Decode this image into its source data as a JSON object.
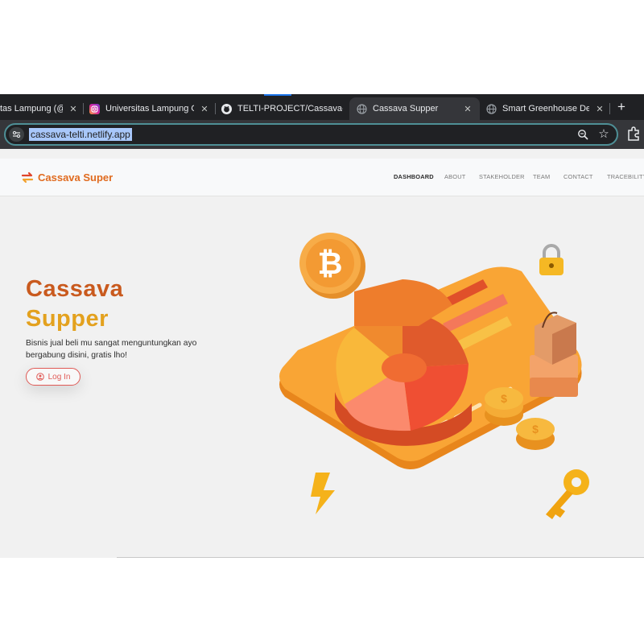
{
  "browser": {
    "tabs": [
      {
        "title": "tas Lampung (@c",
        "icon": "globe-icon"
      },
      {
        "title": "Universitas Lampung Offi",
        "icon": "instagram-icon"
      },
      {
        "title": "TELTI-PROJECT/Cassava-",
        "icon": "github-icon"
      },
      {
        "title": "Cassava Supper",
        "icon": "globe-icon",
        "active": true
      },
      {
        "title": "Smart Greenhouse Desa",
        "icon": "globe-icon"
      }
    ],
    "new_tab_symbol": "+",
    "url": "cassava-telti.netlify.app",
    "site_info_symbol": "⚙",
    "star_symbol": "☆",
    "close_symbol": "✕"
  },
  "site": {
    "brand": "Cassava Super",
    "nav": [
      "DASHBOARD",
      "ABOUT",
      "STAKEHOLDER",
      "TEAM",
      "CONTACT",
      "TRACEBILITY"
    ],
    "hero": {
      "title_line1": "Cassava",
      "title_line2": "Supper",
      "subtitle": "Bisnis jual beli mu sangat menguntungkan ayo bergabung disini, gratis lho!",
      "login_label": "Log In"
    },
    "illustration_icons": [
      "bitcoin-coin-icon",
      "padlock-icon",
      "shopping-bag-icon",
      "dollar-coin-stack-icon",
      "lightning-bolt-icon",
      "key-icon",
      "pie-chart-icon",
      "bar-chart-icon"
    ],
    "colors": {
      "brand_orange": "#e06b1f",
      "title_orange": "#c95a1e",
      "title_gold": "#e3a11e",
      "login_red": "#e05a56",
      "card_orange": "#f9a535"
    }
  }
}
